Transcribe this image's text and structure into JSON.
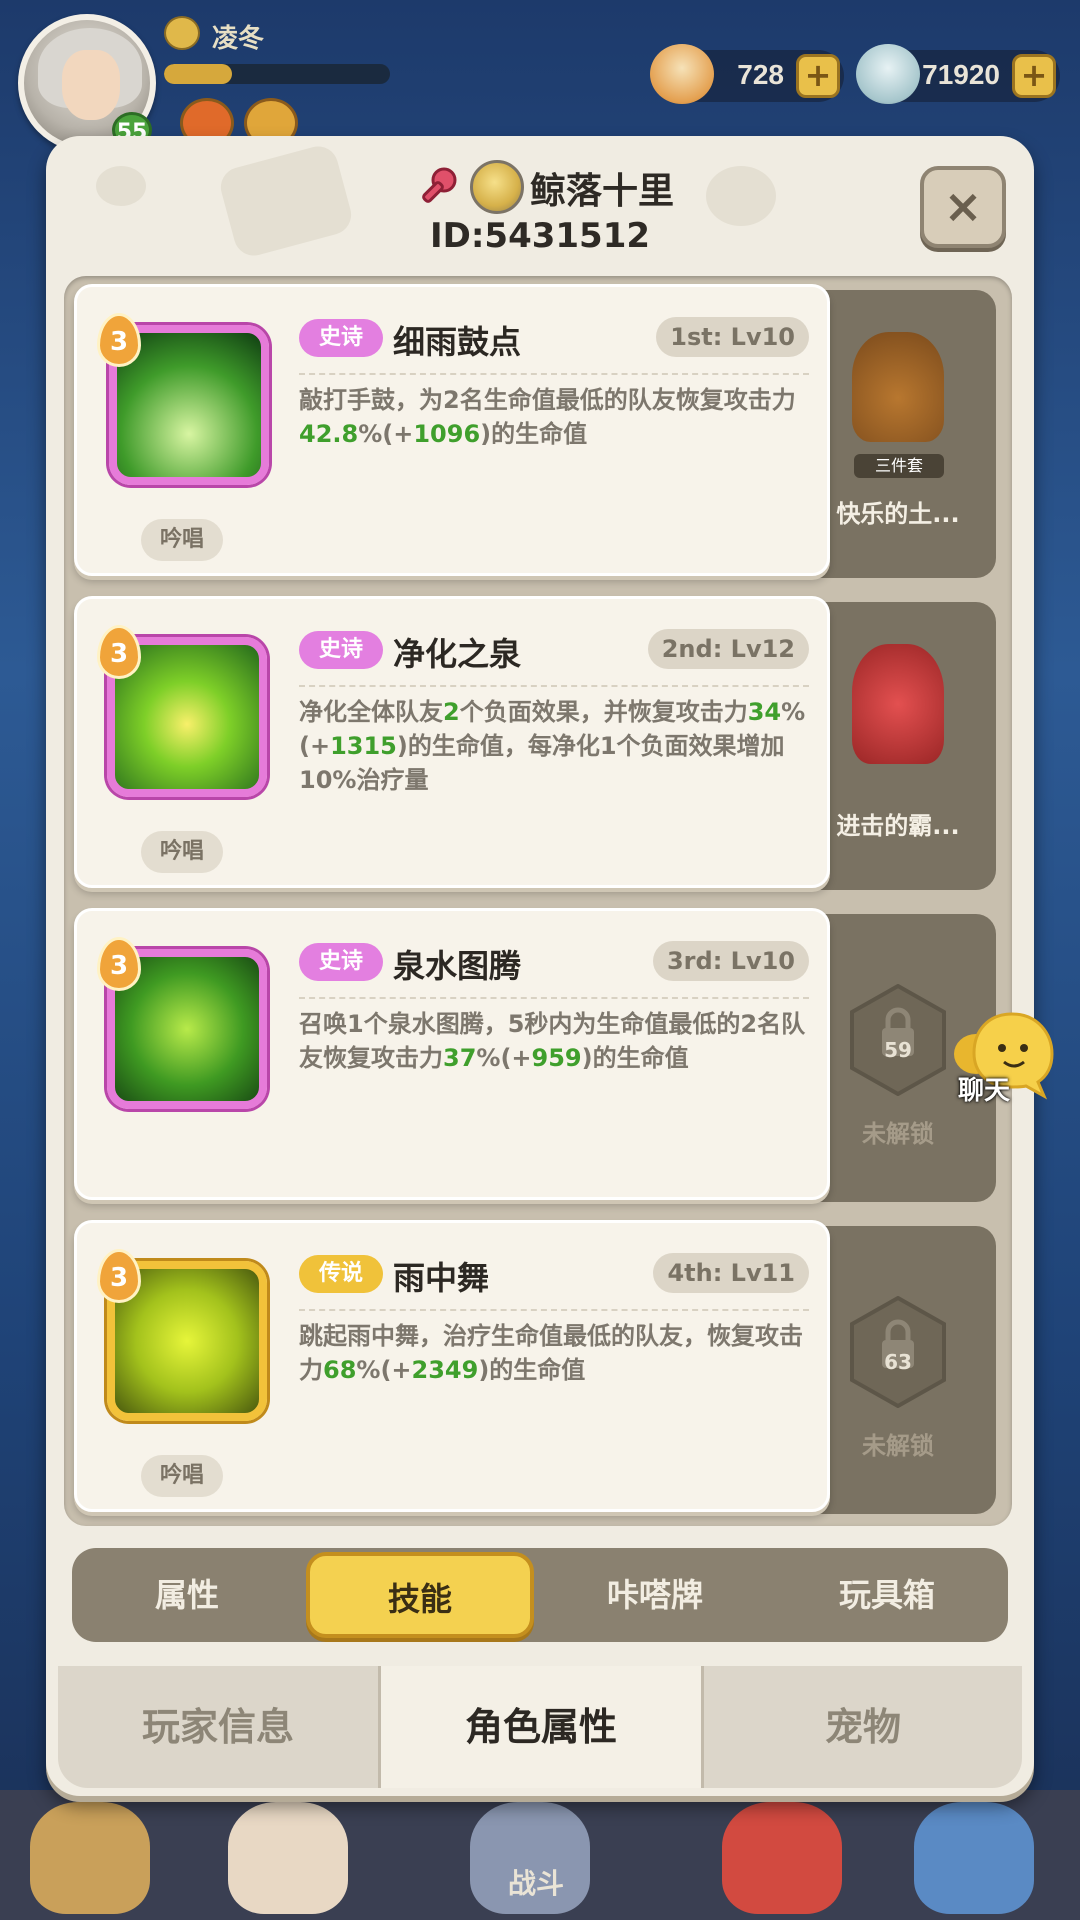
{
  "hud": {
    "player_name": "凌冬",
    "level": "55",
    "xp_fraction": 0.3,
    "currency_1": "728",
    "currency_2": "71920",
    "plus_label": "+"
  },
  "profile": {
    "name": "鲸落十里",
    "id": "ID:5431512",
    "close_label": "×"
  },
  "skills": [
    {
      "level": "3",
      "rarity": "史诗",
      "name": "细雨鼓点",
      "slot": "1st: Lv10",
      "desc_parts": [
        "敲打手鼓，为2名生命值最低的队友恢复攻击力",
        "42.8",
        "%(+",
        "1096",
        ")的生命值"
      ],
      "cast": "吟唱",
      "side_label": "快乐的土...",
      "side_badge": "三件套"
    },
    {
      "level": "3",
      "rarity": "史诗",
      "name": "净化之泉",
      "slot": "2nd: Lv12",
      "desc_parts": [
        "净化全体队友",
        "2",
        "个负面效果，并恢复攻击力",
        "34",
        "%(+",
        "1315",
        ")的生命值，每净化1个负面效果增加10%治疗量"
      ],
      "cast": "吟唱",
      "side_label": "进击的霸..."
    },
    {
      "level": "3",
      "rarity": "史诗",
      "name": "泉水图腾",
      "slot": "3rd: Lv10",
      "desc_parts": [
        "召唤1个泉水图腾，5秒内为生命值最低的2名队友恢复攻击力",
        "37",
        "%(+",
        "959",
        ")的生命值"
      ],
      "side_label": "未解锁",
      "lock_level": "59"
    },
    {
      "level": "3",
      "rarity": "传说",
      "name": "雨中舞",
      "slot": "4th: Lv11",
      "desc_parts": [
        "跳起雨中舞，治疗生命值最低的队友，恢复攻击力",
        "68",
        "%(+",
        "2349",
        ")的生命值"
      ],
      "cast": "吟唱",
      "side_label": "未解锁",
      "lock_level": "63"
    }
  ],
  "tabs": [
    "属性",
    "技能",
    "咔嗒牌",
    "玩具箱"
  ],
  "bottom_tabs": [
    "玩家信息",
    "角色属性",
    "宠物"
  ],
  "chat_label": "聊天",
  "nav": {
    "battle_label": "战斗"
  },
  "colors": {
    "epic": "#e37fe0",
    "legend": "#f0c23a",
    "highlight": "#3f9f2c",
    "active_tab": "#f4d150"
  }
}
